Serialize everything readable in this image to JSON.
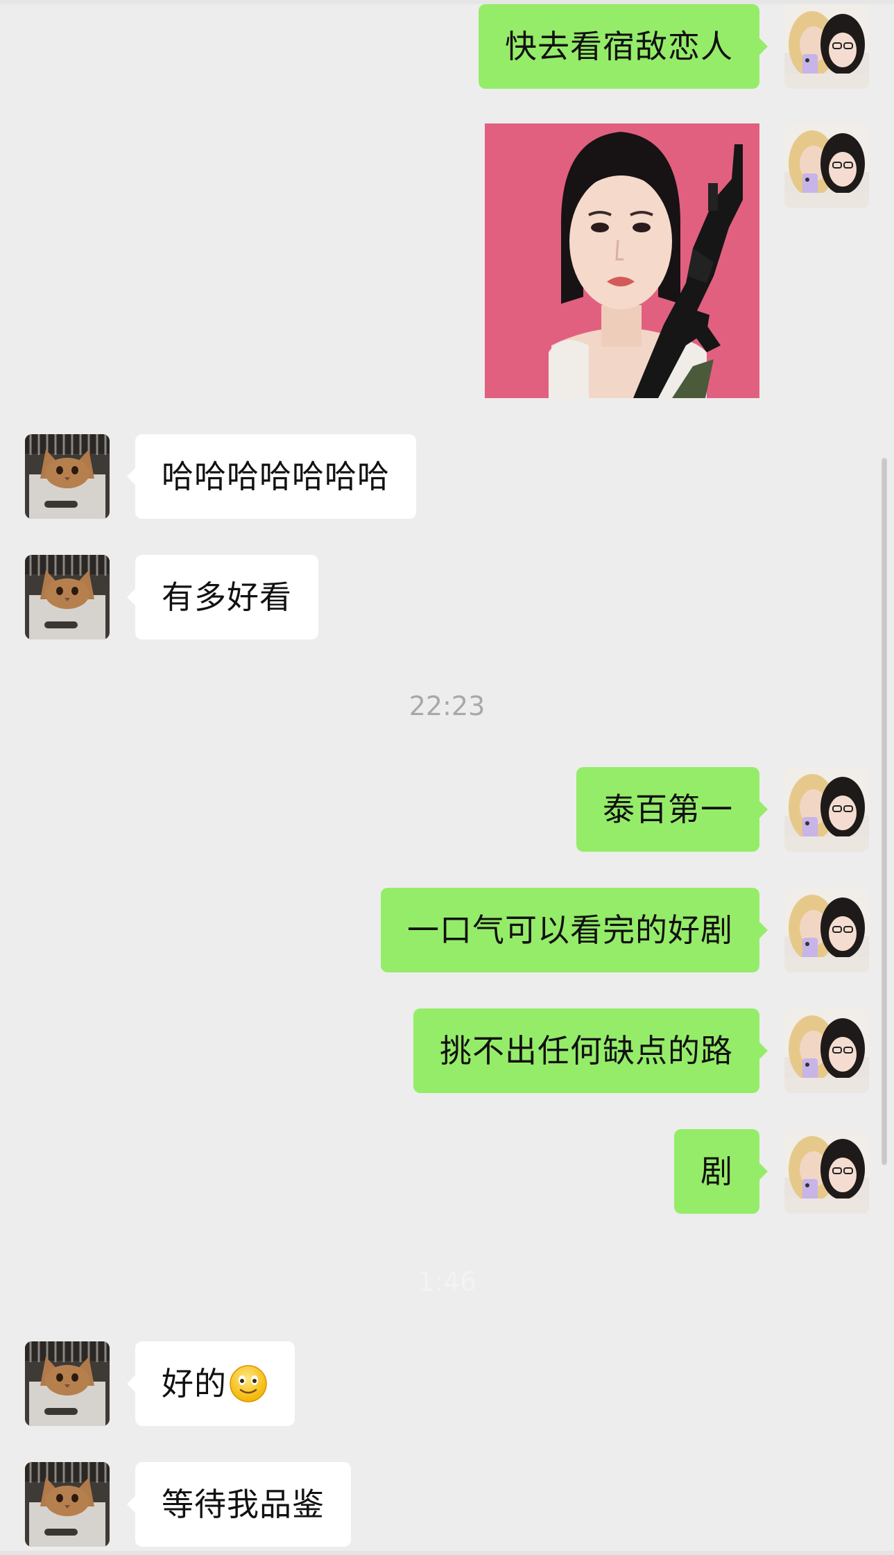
{
  "conversation": {
    "messages": [
      {
        "sender": "self",
        "type": "text",
        "text": "快去看宿敌恋人"
      },
      {
        "sender": "self",
        "type": "image",
        "image_icon": "photo-icon"
      },
      {
        "sender": "other",
        "type": "text",
        "text": "哈哈哈哈哈哈哈"
      },
      {
        "sender": "other",
        "type": "text",
        "text": "有多好看"
      },
      {
        "sender": "self",
        "type": "text",
        "text": "泰百第一"
      },
      {
        "sender": "self",
        "type": "text",
        "text": "一口气可以看完的好剧"
      },
      {
        "sender": "self",
        "type": "text",
        "text": "挑不出任何缺点的路"
      },
      {
        "sender": "self",
        "type": "text",
        "text": "剧"
      },
      {
        "sender": "other",
        "type": "text",
        "text": "好的",
        "emoji": "slightly-smiling-face-icon"
      },
      {
        "sender": "other",
        "type": "text",
        "text": "等待我品鉴"
      }
    ],
    "timestamps": [
      "22:23",
      "1:46"
    ]
  },
  "colors": {
    "background": "#ededed",
    "self_bubble": "#95ec69",
    "other_bubble": "#ffffff",
    "timestamp": "#a8a8a8"
  }
}
